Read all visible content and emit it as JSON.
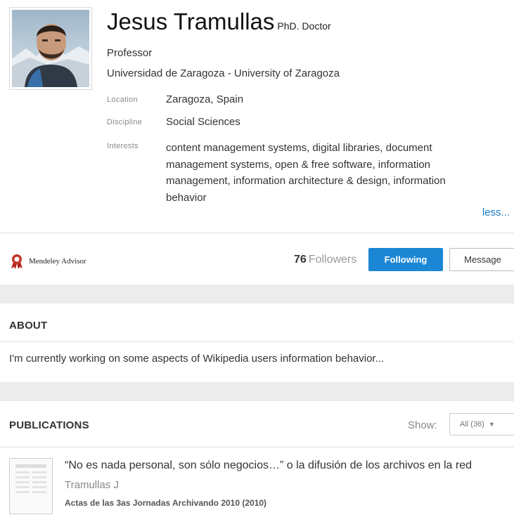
{
  "profile": {
    "name": "Jesus Tramullas",
    "degree": "PhD. Doctor",
    "role": "Professor",
    "affiliation": "Universidad de Zaragoza - University of Zaragoza",
    "location_label": "Location",
    "location": "Zaragoza, Spain",
    "discipline_label": "Discipline",
    "discipline": "Social Sciences",
    "interests_label": "Interests",
    "interests": "content management systems, digital libraries, document management systems, open & free software, information management, information architecture & design, information behavior",
    "less_link": "less..."
  },
  "social": {
    "advisor_badge": "Mendeley Advisor",
    "followers_count": "76",
    "followers_label": "Followers",
    "following_button": "Following",
    "message_button": "Message"
  },
  "about": {
    "title": "ABOUT",
    "text": "I'm currently working on some aspects of Wikipedia users information behavior..."
  },
  "publications": {
    "title": "PUBLICATIONS",
    "show_label": "Show:",
    "show_value": "All (36)",
    "items": [
      {
        "title": "“No es nada personal, son sólo negocios…” o la difusión de los archivos en la red",
        "authors": "Tramullas J",
        "source": "Actas de las 3as Jornadas Archivando 2010 (2010)"
      }
    ]
  },
  "colors": {
    "accent": "#1b86d4",
    "link": "#1f7fc6",
    "badge": "#c0392b",
    "band": "#ececec"
  },
  "icons": {
    "advisor": "ribbon-award-icon",
    "show_caret": "caret-down-icon",
    "publication": "document-thumbnail-icon"
  }
}
